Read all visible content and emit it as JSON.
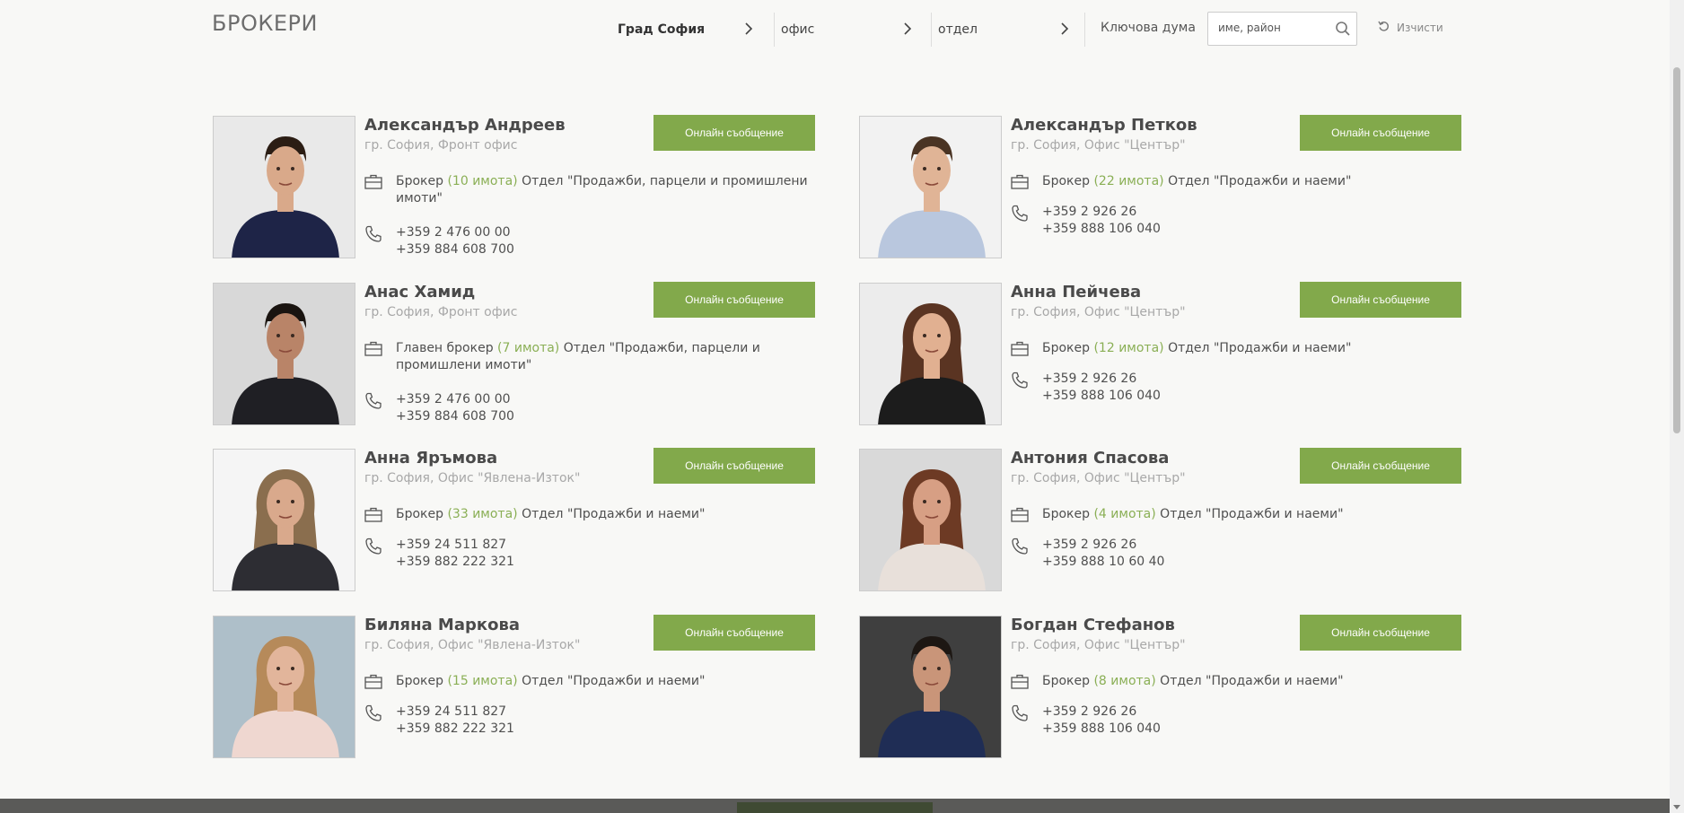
{
  "page": {
    "title": "БРОКЕРИ"
  },
  "filters": {
    "city": "Град София",
    "office": "офис",
    "department": "отдел",
    "keyword_label": "Ключова дума",
    "search_placeholder": "име, район",
    "clear_label": "Изчисти"
  },
  "colors": {
    "accent": "#82a94b",
    "count_text": "#8aaf55"
  },
  "brokers": [
    {
      "name": "Александър Андреев",
      "office": "гр. София, Фронт офис",
      "button": "Онлайн съобщение",
      "role": "Брокер",
      "count": "(10 имота)",
      "department": "Отдел \"Продажби, парцели и промишлени имоти\"",
      "phone1": "+359 2 476 00 00",
      "phone2": "+359 884 608 700"
    },
    {
      "name": "Александър Петков",
      "office": "гр. София, Офис \"Център\"",
      "button": "Онлайн съобщение",
      "role": "Брокер",
      "count": "(22 имота)",
      "department": "Отдел \"Продажби и наеми\"",
      "phone1": "+359 2 926 26",
      "phone2": "+359 888 106 040"
    },
    {
      "name": "Анас Хамид",
      "office": "гр. София, Фронт офис",
      "button": "Онлайн съобщение",
      "role": "Главен брокер",
      "count": "(7 имота)",
      "department": "Отдел \"Продажби, парцели и промишлени имоти\"",
      "phone1": "+359 2 476 00 00",
      "phone2": "+359 884 608 700"
    },
    {
      "name": "Анна Пейчева",
      "office": "гр. София, Офис \"Център\"",
      "button": "Онлайн съобщение",
      "role": "Брокер",
      "count": "(12 имота)",
      "department": "Отдел \"Продажби и наеми\"",
      "phone1": "+359 2 926 26",
      "phone2": "+359 888 106 040"
    },
    {
      "name": "Анна Яръмова",
      "office": "гр. София, Офис \"Явлена-Изток\"",
      "button": "Онлайн съобщение",
      "role": "Брокер",
      "count": "(33 имота)",
      "department": "Отдел \"Продажби и наеми\"",
      "phone1": "+359 24 511 827",
      "phone2": "+359 882 222 321"
    },
    {
      "name": "Антония Спасова",
      "office": "гр. София, Офис \"Център\"",
      "button": "Онлайн съобщение",
      "role": "Брокер",
      "count": "(4 имота)",
      "department": "Отдел \"Продажби и наеми\"",
      "phone1": "+359 2 926 26",
      "phone2": "+359 888 10 60 40"
    },
    {
      "name": "Биляна Маркова",
      "office": "гр. София, Офис \"Явлена-Изток\"",
      "button": "Онлайн съобщение",
      "role": "Брокер",
      "count": "(15 имота)",
      "department": "Отдел \"Продажби и наеми\"",
      "phone1": "+359 24 511 827",
      "phone2": "+359 882 222 321"
    },
    {
      "name": "Богдан Стефанов",
      "office": "гр. София, Офис \"Център\"",
      "button": "Онлайн съобщение",
      "role": "Брокер",
      "count": "(8 имота)",
      "department": "Отдел \"Продажби и наеми\"",
      "phone1": "+359 2 926 26",
      "phone2": "+359 888 106 040"
    }
  ]
}
